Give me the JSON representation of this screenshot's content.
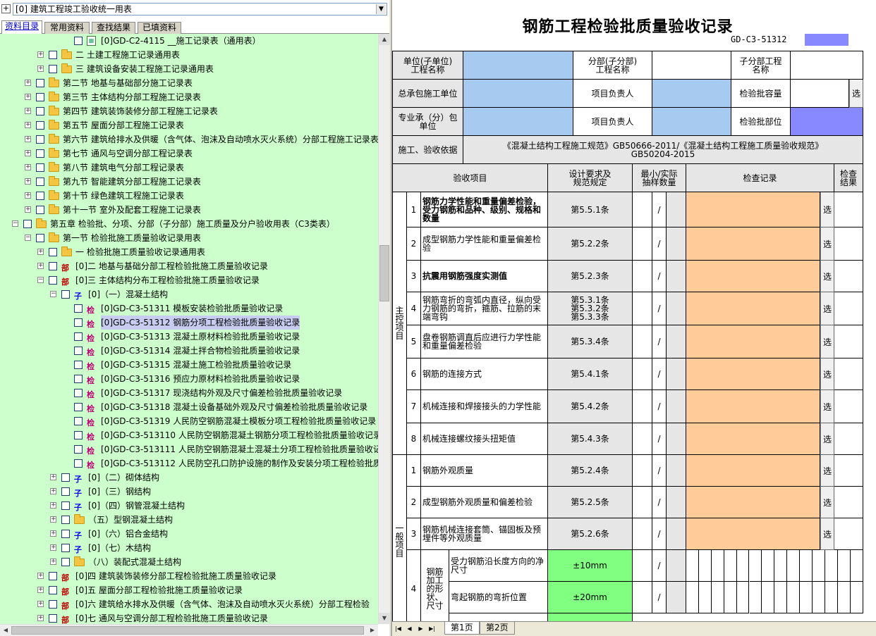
{
  "combo": {
    "text": "[0] 建筑工程竣工验收统一用表",
    "plus": "+"
  },
  "tabs": [
    "资料目录",
    "常用资料",
    "查找结果",
    "已填资料"
  ],
  "tree": [
    {
      "lvl": 6,
      "icon": "doc",
      "text": "[0]GD-C2-4115 __施工记录表（通用表）",
      "exp": ""
    },
    {
      "lvl": 4,
      "icon": "folder",
      "text": "二 土建工程施工记录通用表",
      "exp": "+"
    },
    {
      "lvl": 4,
      "icon": "folder",
      "text": "三 建筑设备安装工程施工记录通用表",
      "exp": "+"
    },
    {
      "lvl": 3,
      "icon": "folder",
      "text": "第二节 地基与基础部分施工记录表",
      "exp": "+"
    },
    {
      "lvl": 3,
      "icon": "folder",
      "text": "第三节 主体结构分部工程施工记录表",
      "exp": "+"
    },
    {
      "lvl": 3,
      "icon": "folder",
      "text": "第四节 建筑装饰装修分部工程施工记录表",
      "exp": "+"
    },
    {
      "lvl": 3,
      "icon": "folder",
      "text": "第五节 屋面分部工程施工记录表",
      "exp": "+"
    },
    {
      "lvl": 3,
      "icon": "folder",
      "text": "第六节 建筑给排水及供暖（含气体、泡沫及自动喷水灭火系统）分部工程施工记录表",
      "exp": "+"
    },
    {
      "lvl": 3,
      "icon": "folder",
      "text": "第七节 通风与空调分部工程记录表",
      "exp": "+"
    },
    {
      "lvl": 3,
      "icon": "folder",
      "text": "第八节 建筑电气分部工程记录表",
      "exp": "+"
    },
    {
      "lvl": 3,
      "icon": "folder",
      "text": "第九节 智能建筑分部工程施工记录表",
      "exp": "+"
    },
    {
      "lvl": 3,
      "icon": "folder",
      "text": "第十节 绿色建筑工程施工记录表",
      "exp": "+"
    },
    {
      "lvl": 3,
      "icon": "folder",
      "text": "第十一节 室外及配套工程施工记录表",
      "exp": "+"
    },
    {
      "lvl": 2,
      "icon": "folder",
      "text": "第五章 检验批、分项、分部（子分部）施工质量及分户验收用表（C3类表）",
      "exp": "-"
    },
    {
      "lvl": 3,
      "icon": "folder",
      "text": "第一节 检验批施工质量验收记录用表",
      "exp": "-"
    },
    {
      "lvl": 4,
      "icon": "folder",
      "text": "一 检验批施工质量验收记录通用表",
      "exp": "+"
    },
    {
      "lvl": 4,
      "icon": "bu",
      "iconText": "部",
      "text": "[0]二 地基与基础分部工程检验批施工质量验收记录",
      "exp": "+"
    },
    {
      "lvl": 4,
      "icon": "bu",
      "iconText": "部",
      "text": "[0]三 主体结构分布工程检验批施工质量验收记录",
      "exp": "-"
    },
    {
      "lvl": 5,
      "icon": "zi",
      "iconText": "子",
      "text": "[0]（一）混凝土结构",
      "exp": "-"
    },
    {
      "lvl": 6,
      "icon": "jian",
      "iconText": "检",
      "text": "[0]GD-C3-51311 模板安装检验批质量验收记录",
      "exp": ""
    },
    {
      "lvl": 6,
      "icon": "jian",
      "iconText": "检",
      "text": "[0]GD-C3-51312 钢筋分项工程检验批质量验收记录",
      "exp": "",
      "sel": true
    },
    {
      "lvl": 6,
      "icon": "jian",
      "iconText": "检",
      "text": "[0]GD-C3-51313 混凝土原材料检验批质量验收记录",
      "exp": ""
    },
    {
      "lvl": 6,
      "icon": "jian",
      "iconText": "检",
      "text": "[0]GD-C3-51314 混凝土拌合物检验批质量验收记录",
      "exp": ""
    },
    {
      "lvl": 6,
      "icon": "jian",
      "iconText": "检",
      "text": "[0]GD-C3-51315 混凝土施工检验批质量验收记录",
      "exp": ""
    },
    {
      "lvl": 6,
      "icon": "jian",
      "iconText": "检",
      "text": "[0]GD-C3-51316 预应力原材料检验批质量验收记录",
      "exp": ""
    },
    {
      "lvl": 6,
      "icon": "jian",
      "iconText": "检",
      "text": "[0]GD-C3-51317 现浇结构外观及尺寸偏差检验批质量验收记录",
      "exp": ""
    },
    {
      "lvl": 6,
      "icon": "jian",
      "iconText": "检",
      "text": "[0]GD-C3-51318 混凝土设备基础外观及尺寸偏差检验批质量验收记录",
      "exp": ""
    },
    {
      "lvl": 6,
      "icon": "jian",
      "iconText": "检",
      "text": "[0]GD-C3-51319 人民防空钢筋混凝土模板分项工程检验批质量验收记录",
      "exp": ""
    },
    {
      "lvl": 6,
      "icon": "jian",
      "iconText": "检",
      "text": "[0]GD-C3-513110 人民防空钢筋混凝土钢筋分项工程检验批质量验收记录",
      "exp": ""
    },
    {
      "lvl": 6,
      "icon": "jian",
      "iconText": "检",
      "text": "[0]GD-C3-513111 人民防空钢筋混凝土混凝土分项工程检验批质量验收记",
      "exp": ""
    },
    {
      "lvl": 6,
      "icon": "jian",
      "iconText": "检",
      "text": "[0]GD-C3-513112 人民防空孔口防护设施的制作及安装分项工程检验批质",
      "exp": ""
    },
    {
      "lvl": 5,
      "icon": "zi",
      "iconText": "子",
      "text": "[0]（二）砌体结构",
      "exp": "+"
    },
    {
      "lvl": 5,
      "icon": "zi",
      "iconText": "子",
      "text": "[0]（三）钢结构",
      "exp": "+"
    },
    {
      "lvl": 5,
      "icon": "zi",
      "iconText": "子",
      "text": "[0]（四）钢管混凝土结构",
      "exp": "+"
    },
    {
      "lvl": 5,
      "icon": "folder",
      "text": "（五）型钢混凝土结构",
      "exp": "+"
    },
    {
      "lvl": 5,
      "icon": "zi",
      "iconText": "子",
      "text": "[0]（六）铝合金结构",
      "exp": "+"
    },
    {
      "lvl": 5,
      "icon": "zi",
      "iconText": "子",
      "text": "[0]（七）木结构",
      "exp": "+"
    },
    {
      "lvl": 5,
      "icon": "folder",
      "text": "（八）装配式混凝土结构",
      "exp": "+"
    },
    {
      "lvl": 4,
      "icon": "bu",
      "iconText": "部",
      "text": "[0]四 建筑装饰装修分部工程检验批施工质量验收记录",
      "exp": "+"
    },
    {
      "lvl": 4,
      "icon": "bu",
      "iconText": "部",
      "text": "[0]五 屋面分部工程检验批施工质量验收记录",
      "exp": "+"
    },
    {
      "lvl": 4,
      "icon": "bu",
      "iconText": "部",
      "text": "[0]六 建筑给水排水及供暖（含气体、泡沫及自动喷水灭火系统）分部工程检验",
      "exp": "+"
    },
    {
      "lvl": 4,
      "icon": "bu",
      "iconText": "部",
      "text": "[0]七 通风与空调分部工程检验批施工质量验收记录",
      "exp": "+"
    }
  ],
  "sheet": {
    "title": "钢筋工程检验批质量验收记录",
    "code": "GD-C3-51312",
    "row1": {
      "a": "单位(子单位)\n工程名称",
      "b": "分部(子分部)\n工程名称",
      "c": "子分部工程\n名称"
    },
    "row2": {
      "a": "总承包施工单位",
      "b": "项目负责人",
      "c": "检验批容量",
      "btn": "选"
    },
    "row3": {
      "a": "专业承（分）包\n单位",
      "b": "项目负责人",
      "c": "检验批部位"
    },
    "row4": {
      "a": "施工、验收依据",
      "b": "《混凝土结构工程施工规范》GB50666-2011/《混凝土结构工程施工质量验收规范》\nGB50204-2015"
    },
    "header": {
      "item": "验收项目",
      "spec": "设计要求及\n规范规定",
      "count": "最小/实际\n抽样数量",
      "record": "检查记录",
      "result": "检查\n结果"
    },
    "main_label": "主\n控\n项\n目",
    "general_label": "一\n般\n项\n目",
    "slash": "/",
    "select": "选",
    "main_rows": [
      {
        "n": "1",
        "item": "钢筋力学性能和重量偏差检验，受力钢筋和品种、级别、规格和数量",
        "spec": "第5.5.1条",
        "bold": true
      },
      {
        "n": "2",
        "item": "成型钢筋力学性能和重量偏差检验",
        "spec": "第5.2.2条"
      },
      {
        "n": "3",
        "item": "抗震用钢筋强度实测值",
        "spec": "第5.2.3条",
        "bold": true
      },
      {
        "n": "4",
        "item": "钢筋弯折的弯弧内直径，纵向受力钢筋的弯折，箍筋、拉筋的末端弯钩",
        "spec": "第5.3.1条\n第5.3.2条\n第5.3.3条"
      },
      {
        "n": "5",
        "item": "盘卷钢筋调直后应进行力学性能和重量偏差检验",
        "spec": "第5.3.4条"
      },
      {
        "n": "6",
        "item": "钢筋的连接方式",
        "spec": "第5.4.1条"
      },
      {
        "n": "7",
        "item": "机械连接和焊接接头的力学性能",
        "spec": "第5.4.2条"
      },
      {
        "n": "8",
        "item": "机械连接螺纹接头扭矩值",
        "spec": "第5.4.3条"
      }
    ],
    "general_rows": [
      {
        "n": "1",
        "item": "钢筋外观质量",
        "spec": "第5.2.4条"
      },
      {
        "n": "2",
        "item": "成型钢筋外观质量和偏差检验",
        "spec": "第5.2.5条"
      },
      {
        "n": "3",
        "item": "钢筋机械连接套筒、锚固板及预埋件等外观质量",
        "spec": "第5.2.6条"
      }
    ],
    "row4g": {
      "n": "4",
      "group": "钢筋\n加工\n的形\n状、\n尺寸",
      "subs": [
        {
          "item": "受力钢筋沿长度方向的净尺寸",
          "spec": "±10mm"
        },
        {
          "item": "弯起钢筋的弯折位置",
          "spec": "±20mm"
        }
      ]
    }
  },
  "sheet_tabs": [
    "第1页",
    "第2页"
  ]
}
